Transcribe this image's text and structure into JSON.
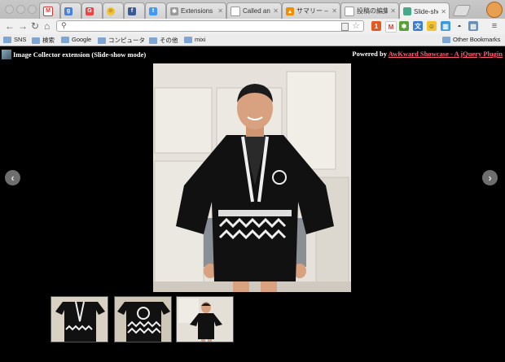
{
  "browser": {
    "tabs": [
      {
        "label": "",
        "icon": "gmail-icon",
        "color": "#d33"
      },
      {
        "label": "",
        "icon": "google-plus-icon",
        "color": "#4a7fd8"
      },
      {
        "label": "",
        "icon": "igoogle-icon",
        "color": "#e44"
      },
      {
        "label": "",
        "icon": "smiley-icon",
        "color": "#f3c22e"
      },
      {
        "label": "",
        "icon": "facebook-icon",
        "color": "#3b5998"
      },
      {
        "label": "",
        "icon": "twitter-icon",
        "color": "#4099ff"
      },
      {
        "label": "Extensions",
        "icon": "puzzle-icon",
        "color": "#777"
      },
      {
        "label": "Called angel",
        "icon": "page-icon",
        "color": "#888"
      },
      {
        "label": "サマリー – Go",
        "icon": "analytics-icon",
        "color": "#f28c00"
      },
      {
        "label": "投稿の編集 ‹",
        "icon": "page-icon",
        "color": "#888"
      },
      {
        "label": "Slide-show b",
        "icon": "image-icon",
        "color": "#4a8"
      }
    ],
    "omnibox_value": "",
    "bookmarks": [
      "SNS",
      "検索",
      "Google",
      "コンピュータ",
      "その他",
      "mixi"
    ],
    "other_bookmarks": "Other Bookmarks"
  },
  "page": {
    "title": "Image Collector extension (Slide-show mode)",
    "powered_by": "Powered by",
    "powered_link": "AwKward Showcase - A jQuery Plugin",
    "prev_label": "‹",
    "next_label": "›",
    "thumbnail_count": 3
  }
}
